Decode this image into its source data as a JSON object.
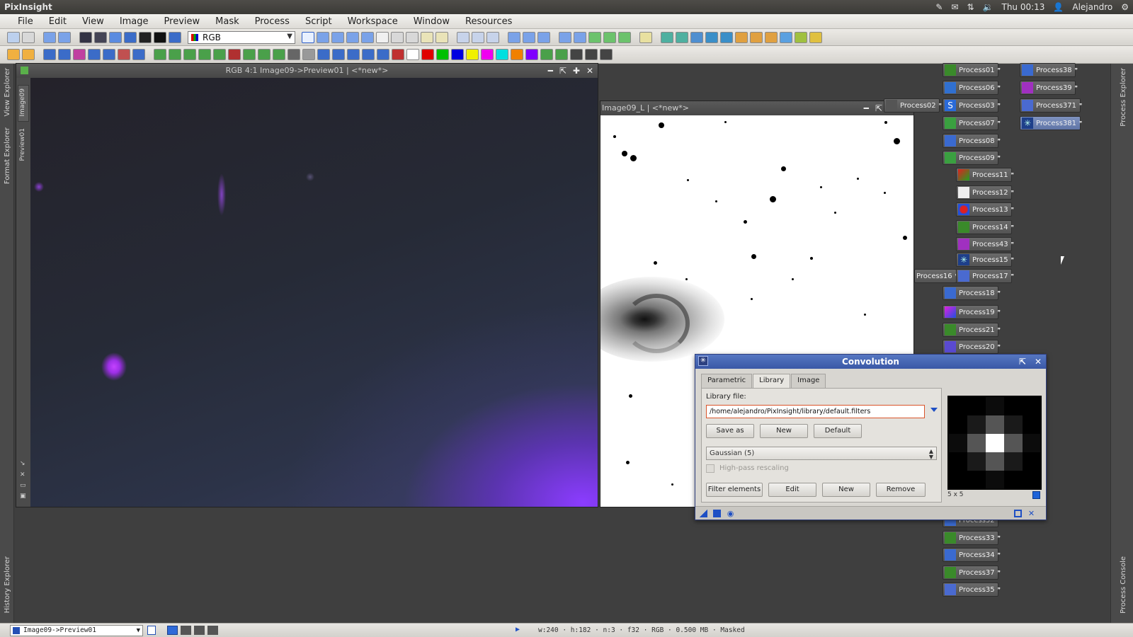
{
  "topbar": {
    "app_name": "PixInsight",
    "clock": "Thu 00:13",
    "user": "Alejandro"
  },
  "menu": [
    "File",
    "Edit",
    "View",
    "Image",
    "Preview",
    "Mask",
    "Process",
    "Script",
    "Workspace",
    "Window",
    "Resources"
  ],
  "toolbar": {
    "color_space_value": "RGB"
  },
  "side_labels": {
    "view_explorer": "View Explorer",
    "format_explorer": "Format Explorer",
    "history_explorer": "History Explorer",
    "process_explorer": "Process Explorer",
    "process_console": "Process Console"
  },
  "image_window_1": {
    "title": "RGB 4:1 Image09->Preview01 | <*new*>",
    "tab_image": "Image09",
    "tab_preview": "Preview01"
  },
  "image_window_2": {
    "title": "Image09_L | <*new*>"
  },
  "process_icons": [
    "Process01",
    "Process06",
    "Process03",
    "Process07",
    "Process08",
    "Process09",
    "Process11",
    "Process12",
    "Process13",
    "Process14",
    "Process43",
    "Process15",
    "Process17",
    "Process18",
    "Process19",
    "Process21",
    "Process20",
    "Process32",
    "Process33",
    "Process34",
    "Process37",
    "Process35",
    "Process38",
    "Process39",
    "Process371",
    "Process381",
    "Process02",
    "Process16"
  ],
  "convolution": {
    "title": "Convolution",
    "tabs": [
      "Parametric",
      "Library",
      "Image"
    ],
    "active_tab": "Library",
    "library_file_label": "Library file:",
    "library_file_value": "/home/alejandro/PixInsight/library/default.filters",
    "buttons": {
      "save_as": "Save as",
      "new": "New",
      "default": "Default",
      "filter_elements": "Filter elements",
      "edit": "Edit",
      "new2": "New",
      "remove": "Remove"
    },
    "filter_selected": "Gaussian (5)",
    "high_pass_label": "High-pass rescaling",
    "high_pass_checked": false,
    "kernel_size_label": "5 x 5"
  },
  "statusbar": {
    "view_selector": "Image09->Preview01",
    "info": "w:240 · h:182 · n:3 · f32 · RGB · 0.500 MB · Masked"
  },
  "colors": {
    "accent": "#3a58a6",
    "field_border": "#d9542a",
    "nebula": "#8b3cff"
  }
}
